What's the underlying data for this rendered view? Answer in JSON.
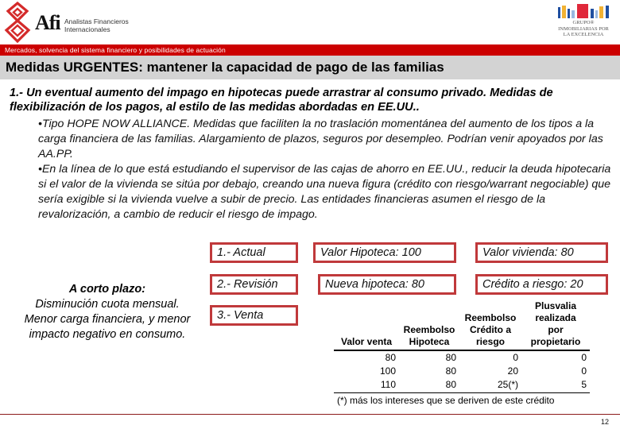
{
  "header": {
    "logo_brand": "Afi",
    "logo_text_line1": "Analistas Financieros",
    "logo_text_line2": "Internacionales",
    "partner_logo_line1": "GRUPO®",
    "partner_logo_line2": "INMOBILIARIAS POR",
    "partner_logo_line3": "LA EXCELENCIA",
    "section_label": "Mercados, solvencia del sistema financiero y posibilidades de actuación",
    "colors": {
      "band": "#cc0000",
      "title_band": "#d3d3d3",
      "box_border": "#c0393b"
    }
  },
  "slide": {
    "title": "Medidas URGENTES: mantener la capacidad de pago de las familias",
    "lead": "1.- Un eventual aumento del impago en hipotecas puede arrastrar al consumo privado. Medidas de flexibilización de los pagos, al estilo de las medidas abordadas en EE.UU..",
    "bullets": [
      "•Tipo HOPE NOW ALLIANCE. Medidas que faciliten la no traslación momentánea del aumento de los tipos a la carga financiera de las familias. Alargamiento de plazos, seguros por desempleo. Podrían venir apoyados por las AA.PP.",
      "•En la línea de lo que está estudiando el supervisor de las cajas de ahorro en EE.UU., reducir la deuda hipotecaria si el valor de la vivienda  se sitúa por debajo, creando una nueva figura (crédito con riesgo/warrant negociable) que sería exigible si la vivienda vuelve a subir de precio. Las entidades financieras asumen el riesgo de la revalorización, a cambio de reducir el riesgo de impago."
    ],
    "short_term": {
      "heading": "A corto plazo:",
      "body": "Disminución cuota mensual. Menor carga financiera, y menor impacto negativo en consumo."
    },
    "steps": [
      {
        "label": "1.- Actual"
      },
      {
        "label": "2.- Revisión"
      },
      {
        "label": "3.- Venta"
      }
    ],
    "values": {
      "valor_hipoteca": "Valor Hipoteca: 100",
      "valor_vivienda": "Valor vivienda: 80",
      "nueva_hipoteca": "Nueva hipoteca: 80",
      "credito_riesgo": "Crédito a riesgo: 20"
    },
    "table": {
      "headers": [
        "Valor venta",
        "Reembolso Hipoteca",
        "Reembolso Crédito a riesgo",
        "Plusvalía realizada por propietario"
      ],
      "header_lines": [
        [
          "Valor venta"
        ],
        [
          "Reembolso",
          "Hipoteca"
        ],
        [
          "Reembolso",
          "Crédito a",
          "riesgo"
        ],
        [
          "Plusvalia",
          "realizada",
          "por",
          "propietario"
        ]
      ],
      "rows": [
        [
          "80",
          "80",
          "0",
          "0"
        ],
        [
          "100",
          "80",
          "20",
          "0"
        ],
        [
          "110",
          "80",
          "25(*)",
          "5"
        ]
      ],
      "footnote": "(*) más los intereses que se deriven de este crédito"
    },
    "page_number": "12"
  }
}
